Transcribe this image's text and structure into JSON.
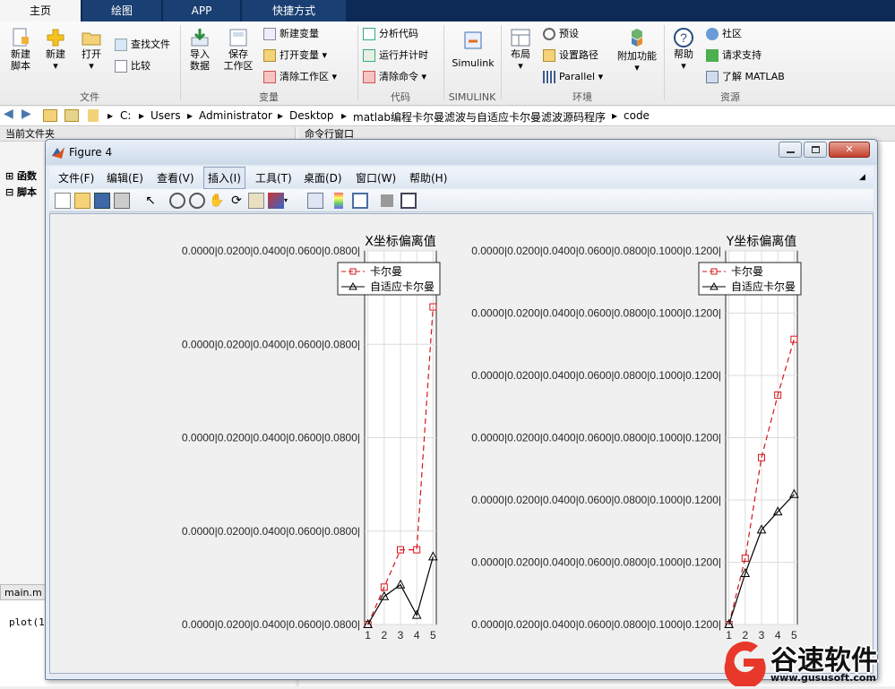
{
  "tabs": [
    "主页",
    "绘图",
    "APP",
    "快捷方式"
  ],
  "ribbon": {
    "new_script": "新建\n脚本",
    "new": "新建",
    "open": "打开",
    "find_files": "查找文件",
    "compare": "比较",
    "import_data": "导入\n数据",
    "save_workspace": "保存\n工作区",
    "new_variable": "新建变量",
    "open_variable": "打开变量",
    "clear_workspace": "清除工作区",
    "analyze_code": "分析代码",
    "run_time": "运行并计时",
    "clear_commands": "清除命令",
    "simulink": "Simulink",
    "layout": "布局",
    "preferences": "预设",
    "set_path": "设置路径",
    "parallel": "Parallel",
    "addons": "附加功能",
    "help": "帮助",
    "community": "社区",
    "request_support": "请求支持",
    "learn_matlab": "了解 MATLAB",
    "groups": [
      "文件",
      "变量",
      "代码",
      "SIMULINK",
      "环境",
      "资源"
    ]
  },
  "address": {
    "path": [
      "C:",
      "Users",
      "Administrator",
      "Desktop",
      "matlab编程卡尔曼滤波与自适应卡尔曼滤波源码程序",
      "code"
    ]
  },
  "left_panel": {
    "title": "当前文件夹",
    "items": [
      "函数",
      "脚本"
    ],
    "editor_tab": "main.m",
    "editor_code": "plot(1:"
  },
  "command_window": {
    "title": "命令行窗口"
  },
  "figure": {
    "title": "Figure 4",
    "menu": [
      "文件(F)",
      "编辑(E)",
      "查看(V)",
      "插入(I)",
      "工具(T)",
      "桌面(D)",
      "窗口(W)",
      "帮助(H)"
    ]
  },
  "colors": {
    "kalman": "#d6151b",
    "adaptive": "#000000",
    "tab_bg": "#0c2a55"
  },
  "chart_data": [
    {
      "type": "line",
      "title": "X坐标偏离值",
      "x": [
        1,
        2,
        3,
        4,
        5
      ],
      "series": [
        {
          "name": "卡尔曼",
          "values": [
            0,
            0.008,
            0.016,
            0.016,
            0.068
          ],
          "marker": "square",
          "style": "dashed",
          "color": "#d6151b"
        },
        {
          "name": "自适应卡尔曼",
          "values": [
            0,
            0.006,
            0.0085,
            0.002,
            0.0145
          ],
          "marker": "triangle",
          "style": "solid",
          "color": "#000000"
        }
      ],
      "ytick_labels": [
        "0.0000|0.0200|0.0400|0.0600|0.0800|",
        "0.0000|0.0200|0.0400|0.0600|0.0800|",
        "0.0000|0.0200|0.0400|0.0600|0.0800|",
        "0.0000|0.0200|0.0400|0.0600|0.0800|",
        "0.0000|0.0200|0.0400|0.0600|0.0800|"
      ],
      "xtick_labels": [
        "1",
        "2",
        "3",
        "4",
        "5"
      ],
      "ylim": [
        0,
        0.08
      ],
      "legend": "top-right",
      "grid": true
    },
    {
      "type": "line",
      "title": "Y坐标偏离值",
      "x": [
        1,
        2,
        3,
        4,
        5
      ],
      "series": [
        {
          "name": "卡尔曼",
          "values": [
            0,
            0.0213,
            0.0536,
            0.0737,
            0.0916
          ],
          "marker": "square",
          "style": "dashed",
          "color": "#d6151b"
        },
        {
          "name": "自适应卡尔曼",
          "values": [
            0,
            0.0164,
            0.0304,
            0.0362,
            0.0418
          ],
          "marker": "triangle",
          "style": "solid",
          "color": "#000000"
        }
      ],
      "ytick_labels": [
        "0.0000|0.0200|0.0400|0.0600|0.0800|0.1000|0.1200|",
        "0.0000|0.0200|0.0400|0.0600|0.0800|0.1000|0.1200|",
        "0.0000|0.0200|0.0400|0.0600|0.0800|0.1000|0.1200|",
        "0.0000|0.0200|0.0400|0.0600|0.0800|0.1000|0.1200|",
        "0.0000|0.0200|0.0400|0.0600|0.0800|0.1000|0.1200|",
        "0.0000|0.0200|0.0400|0.0600|0.0800|0.1000|0.1200|",
        "0.0000|0.0200|0.0400|0.0600|0.0800|0.1000|0.1200|"
      ],
      "xtick_labels": [
        "1",
        "2",
        "3",
        "4",
        "5"
      ],
      "ylim": [
        0,
        0.12
      ],
      "legend": "top-right",
      "grid": true
    }
  ],
  "watermark": {
    "brand": "谷速软件",
    "url": "www.gususoft.com"
  }
}
